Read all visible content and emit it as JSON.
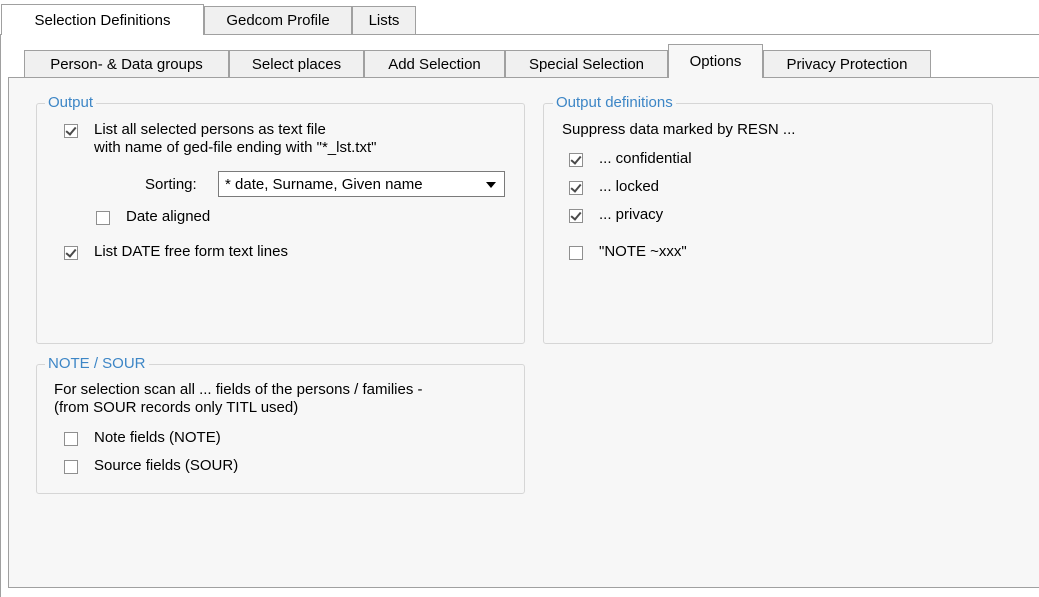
{
  "tabs_top": [
    "Selection Definitions",
    "Gedcom Profile",
    "Lists"
  ],
  "tabs_sub": [
    "Person- & Data groups",
    "Select places",
    "Add Selection",
    "Special Selection",
    "Options",
    "Privacy Protection"
  ],
  "output": {
    "title": "Output",
    "list_text_file_line1": "List all selected persons as text file",
    "list_text_file_line2": "with name of ged-file ending with \"*_lst.txt\"",
    "sorting_label": "Sorting:",
    "sorting_value": "* date, Surname, Given name",
    "date_aligned": "Date aligned",
    "list_date_free": "List DATE free form text lines"
  },
  "output_definitions": {
    "title": "Output definitions",
    "suppress_label": "Suppress data marked by RESN ...",
    "confidential": "... confidential",
    "locked": "... locked",
    "privacy": "... privacy",
    "note_xxx": "\"NOTE ~xxx\""
  },
  "note_sour": {
    "title": "NOTE / SOUR",
    "desc_line1": "For selection scan all ... fields of the persons / families -",
    "desc_line2": "(from SOUR records only TITL used)",
    "note_fields": "Note fields (NOTE)",
    "source_fields": "Source fields (SOUR)"
  }
}
